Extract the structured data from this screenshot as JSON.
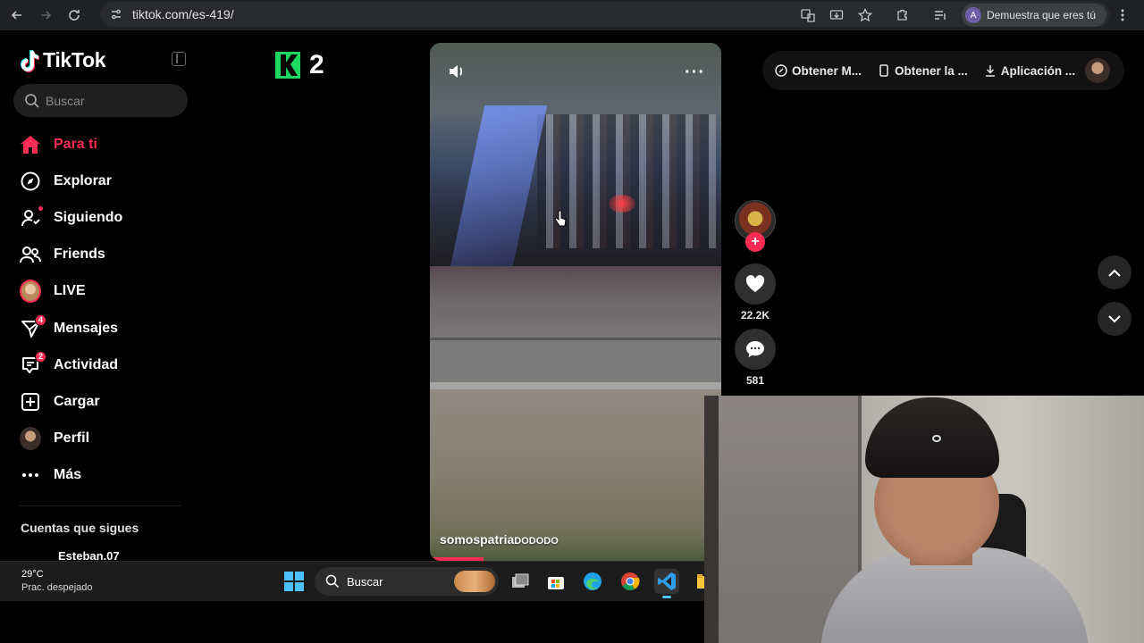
{
  "browser": {
    "url": "tiktok.com/es-419/",
    "profile_label": "Demuestra que eres tú",
    "profile_initial": "A",
    "icons": [
      "back-icon",
      "forward-icon",
      "reload-icon",
      "site-settings-icon",
      "translate-icon",
      "install-icon",
      "star-icon",
      "extensions-icon",
      "media-controls-icon",
      "kebab-menu-icon"
    ]
  },
  "tiktok": {
    "logo_text": "TikTok",
    "search_placeholder": "Buscar",
    "menu": [
      {
        "label": "Para ti",
        "icon": "home-icon",
        "active": true
      },
      {
        "label": "Explorar",
        "icon": "compass-icon"
      },
      {
        "label": "Siguiendo",
        "icon": "following-icon"
      },
      {
        "label": "Friends",
        "icon": "friends-icon"
      },
      {
        "label": "LIVE",
        "icon": "live-avatar-icon"
      },
      {
        "label": "Mensajes",
        "icon": "messages-icon",
        "badge": "4"
      },
      {
        "label": "Actividad",
        "icon": "activity-icon",
        "badge": "2"
      },
      {
        "label": "Cargar",
        "icon": "upload-icon"
      },
      {
        "label": "Perfil",
        "icon": "profile-avatar-icon"
      },
      {
        "label": "Más",
        "icon": "more-icon"
      }
    ],
    "following_title": "Cuentas que sigues",
    "following_accounts": [
      "Esteban.07"
    ],
    "k2_number": "2",
    "video": {
      "author": "somospatria",
      "author_suffix": "DODODO",
      "likes": "22.2K",
      "comments": "581"
    },
    "top_pills": [
      {
        "label": "Obtener M...",
        "icon": "coin-icon"
      },
      {
        "label": "Obtener la ...",
        "icon": "phone-icon"
      },
      {
        "label": "Aplicación ...",
        "icon": "download-icon"
      }
    ]
  },
  "taskbar": {
    "temperature": "29°C",
    "weather": "Prac. despejado",
    "search_label": "Buscar"
  },
  "colors": {
    "accent": "#fe2c55",
    "background": "#000000",
    "browser_chrome": "#202124",
    "taskbar": "#1c1c1c"
  }
}
